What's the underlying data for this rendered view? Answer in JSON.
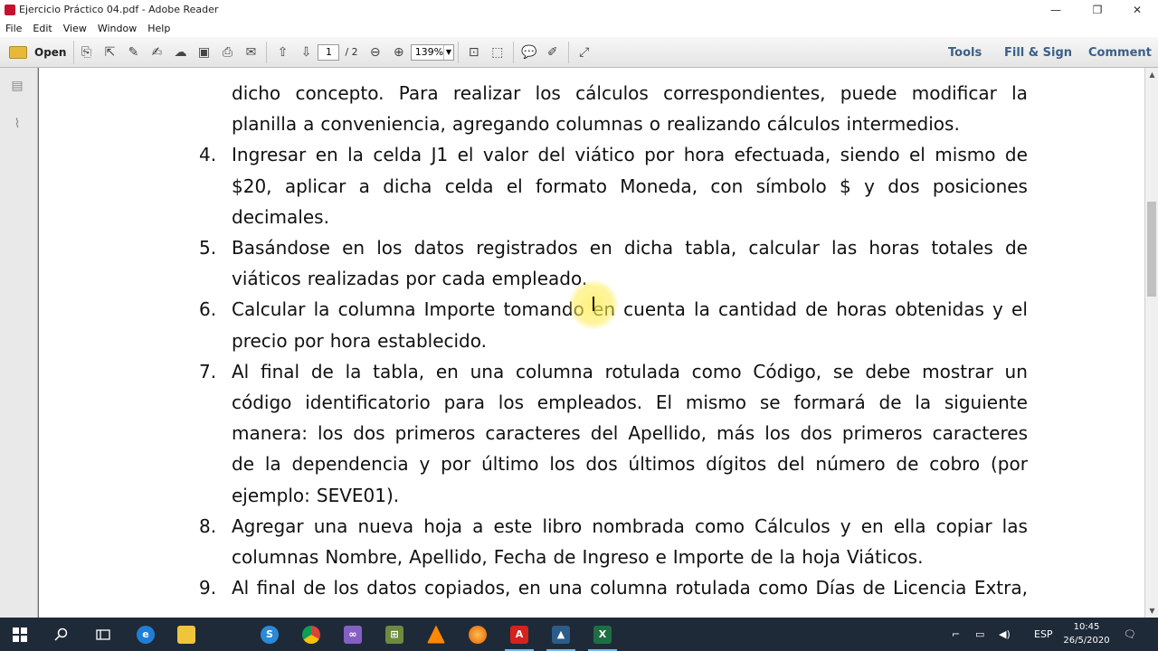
{
  "window": {
    "title": "Ejercicio Práctico 04.pdf - Adobe Reader",
    "minimize": "—",
    "maximize": "❐",
    "close": "✕"
  },
  "menu": [
    "File",
    "Edit",
    "View",
    "Window",
    "Help"
  ],
  "toolbar": {
    "open_label": "Open",
    "current_page": "1",
    "total_pages": "/ 2",
    "zoom": "139%",
    "tools_label": "Tools",
    "fill_sign_label": "Fill & Sign",
    "comment_label": "Comment"
  },
  "document": {
    "items": [
      {
        "number": "",
        "lines": [
          [
            "dicho",
            "concepto.",
            "Para",
            "realizar",
            "los",
            "cálculos",
            "correspondientes,",
            "puede",
            "modificar",
            "la"
          ],
          [
            "planilla",
            "a",
            "conveniencia,",
            "agregando",
            "columnas",
            "o",
            "realizando",
            "cálculos",
            "intermedios."
          ]
        ],
        "last_line_left": true
      },
      {
        "number": "4.",
        "lines": [
          [
            "Ingresar",
            "en",
            "la",
            "celda",
            "J1",
            "el",
            "valor",
            "del",
            "viático",
            "por",
            "hora",
            "efectuada,",
            "siendo",
            "el",
            "mismo",
            "de"
          ],
          [
            "$20,",
            "aplicar",
            "a",
            "dicha",
            "celda",
            "el",
            "formato",
            "Moneda,",
            "con",
            "símbolo",
            "$",
            "y",
            "dos",
            "posiciones"
          ],
          [
            "decimales."
          ]
        ],
        "last_line_left": true
      },
      {
        "number": "5.",
        "lines": [
          [
            "Basándose",
            "en",
            "los",
            "datos",
            "registrados",
            "en",
            "dicha",
            "tabla,",
            "calcular",
            "las",
            "horas",
            "totales",
            "de"
          ],
          [
            "viáticos",
            "realizadas",
            "por",
            "cada",
            "empleado."
          ]
        ],
        "last_line_left": true
      },
      {
        "number": "6.",
        "lines": [
          [
            "Calcular",
            "la",
            "columna",
            "Importe",
            "tomando",
            "en",
            "cuenta",
            "la",
            "cantidad",
            "de",
            "horas",
            "obtenidas",
            "y",
            "el"
          ],
          [
            "precio",
            "por",
            "hora",
            "establecido."
          ]
        ],
        "last_line_left": true
      },
      {
        "number": "7.",
        "lines": [
          [
            "Al",
            "final",
            "de",
            "la",
            "tabla,",
            "en",
            "una",
            "columna",
            "rotulada",
            "como",
            "Código,",
            "se",
            "debe",
            "mostrar",
            "un"
          ],
          [
            "código",
            "identificatorio",
            "para",
            "los",
            "empleados.",
            "El",
            "mismo",
            "se",
            "formará",
            "de",
            "la",
            "siguiente"
          ],
          [
            "manera:",
            "los",
            "dos",
            "primeros",
            "caracteres",
            "del",
            "Apellido,",
            "más",
            "los",
            "dos",
            "primeros",
            "caracteres"
          ],
          [
            "de",
            "la",
            "dependencia",
            "y",
            "por",
            "último",
            "los",
            "dos",
            "últimos",
            "dígitos",
            "del",
            "número",
            "de",
            "cobro",
            "(por"
          ],
          [
            "ejemplo:",
            "SEVE01)."
          ]
        ],
        "last_line_left": true
      },
      {
        "number": "8.",
        "lines": [
          [
            "Agregar",
            "una",
            "nueva",
            "hoja",
            "a",
            "este",
            "libro",
            "nombrada",
            "como",
            "Cálculos",
            "y",
            "en",
            "ella",
            "copiar",
            "las"
          ],
          [
            "columnas",
            "Nombre,",
            "Apellido,",
            "Fecha",
            "de",
            "Ingreso",
            "e",
            "Importe",
            "de",
            "la",
            "hoja",
            "Viáticos."
          ]
        ],
        "last_line_left": true
      },
      {
        "number": "9.",
        "lines": [
          [
            "Al",
            "final",
            "de",
            "los",
            "datos",
            "copiados,",
            "en",
            "una",
            "columna",
            "rotulada",
            "como",
            "Días",
            "de",
            "Licencia",
            "Extra,"
          ]
        ],
        "last_line_left": false
      }
    ]
  },
  "taskbar": {
    "language": "ESP",
    "time": "10:45",
    "date": "26/5/2020"
  },
  "colors": {
    "taskbar": "#1f2a38",
    "toolbar_accent": "#3a5f8a",
    "cursor_highlight": "#ffec50"
  }
}
